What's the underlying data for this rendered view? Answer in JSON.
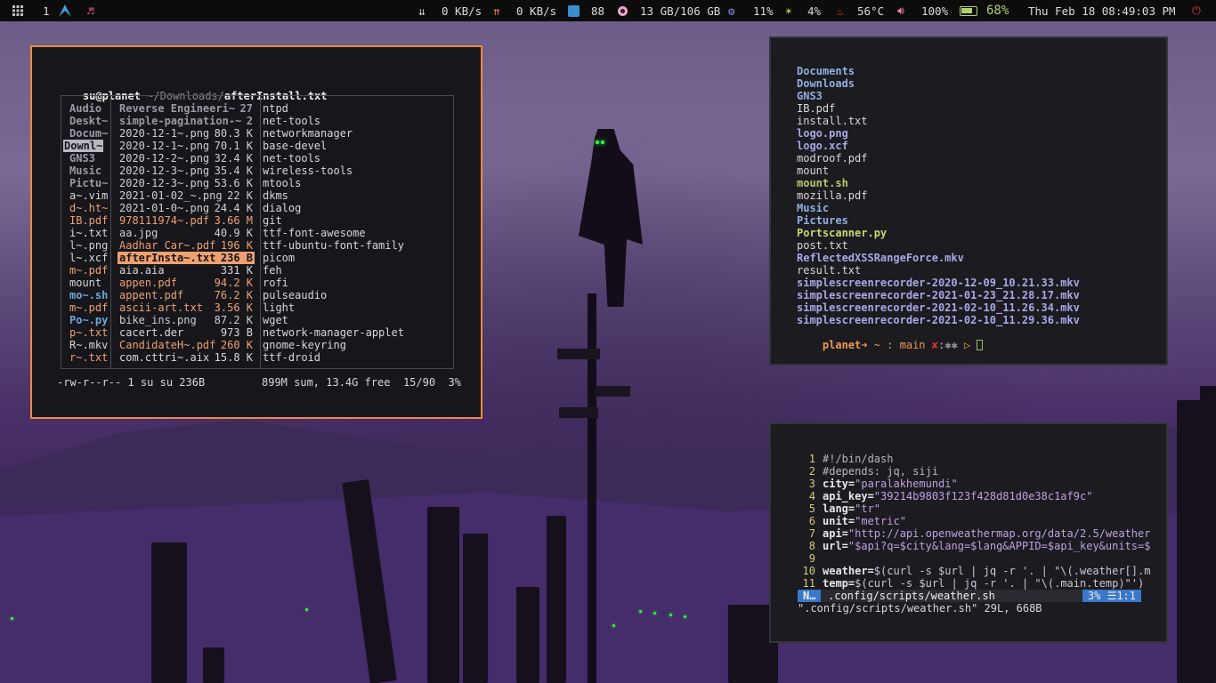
{
  "topbar": {
    "workspace": "1",
    "net_down": "0 KB/s",
    "net_up": "0 KB/s",
    "packages": "88",
    "disk": "13 GB/106 GB",
    "cpu": "11%",
    "brightness": "4%",
    "temp": "56°C",
    "volume": "100%",
    "battery": "68%",
    "datetime": "Thu Feb 18 08:49:03 PM"
  },
  "ranger": {
    "path_user": "su@planet",
    "path_dir": "~/Downloads/",
    "path_file": "afterInstall.txt",
    "col1": [
      "Audio",
      "Deskt~",
      "Docum~",
      "Downl~",
      "GNS3",
      "Music",
      "Pictu~",
      "a~.vim",
      "d~.ht~",
      "IB.pdf",
      "i~.txt",
      "l~.png",
      "l~.xcf",
      "m~.pdf",
      "mount",
      "mo~.sh",
      "m~.pdf",
      "Po~.py",
      "p~.txt",
      "R~.mkv",
      "r~.txt"
    ],
    "col2_names": [
      "Reverse Engineeri~",
      "simple-pagination-~",
      "2020-12-1~.png",
      "2020-12-1~.png",
      "2020-12-2~.png",
      "2020-12-3~.png",
      "2020-12-3~.png",
      "2021-01-02_~.png",
      "2021-01-0~.png",
      "978111974~.pdf",
      "aa.jpg",
      "Aadhar Car~.pdf",
      "afterInsta~.txt",
      "aia.aia",
      "appen.pdf",
      "appent.pdf",
      "ascii-art.txt",
      "bike_ins.png",
      "cacert.der",
      "CandidateH~.pdf",
      "com.cttri~.aix"
    ],
    "col2_sizes": [
      "27",
      "2",
      "80.3 K",
      "70.1 K",
      "32.4 K",
      "35.4 K",
      "53.6 K",
      "22 K",
      "24.4 K",
      "3.66 M",
      "40.9 K",
      "196 K",
      "236 B",
      "331 K",
      "94.2 K",
      "76.2 K",
      "3.56 K",
      "87.2 K",
      "973 B",
      "260 K",
      "15.8 K"
    ],
    "col3": [
      "ntpd",
      "net-tools",
      "networkmanager",
      "base-devel",
      "net-tools",
      "wireless-tools",
      "mtools",
      "dkms",
      "dialog",
      "git",
      "ttf-font-awesome",
      "ttf-ubuntu-font-family",
      "picom",
      "feh",
      "rofi",
      "pulseaudio",
      "light",
      "wget",
      "network-manager-applet",
      "gnome-keyring",
      "ttf-droid"
    ],
    "status_perm": "-rw-r--r-- 1 su su 236B",
    "status_info": "899M sum, 13.4G free  15/90  3%"
  },
  "ls": {
    "items": [
      "Documents",
      "Downloads",
      "GNS3",
      "IB.pdf",
      "install.txt",
      "logo.png",
      "logo.xcf",
      "modroof.pdf",
      "mount",
      "mount.sh",
      "mozilla.pdf",
      "Music",
      "Pictures",
      "Portscanner.py",
      "post.txt",
      "ReflectedXSSRangeForce.mkv",
      "result.txt",
      "simplescreenrecorder-2020-12-09_10.21.33.mkv",
      "simplescreenrecorder-2021-01-23_21.28.17.mkv",
      "simplescreenrecorder-2021-02-10_11.26.34.mkv",
      "simplescreenrecorder-2021-02-10_11.29.36.mkv"
    ],
    "prompt_host": "planet",
    "prompt_rest": " ~ : main ",
    "prompt_x": "✘",
    "prompt_colon": ":",
    "prompt_tail": "▷ "
  },
  "vim": {
    "lines": [
      {
        "n": "1",
        "a": "#!/bin/dash",
        "b": ""
      },
      {
        "n": "2",
        "a": "#depends: jq, siji",
        "b": ""
      },
      {
        "n": "3",
        "a": "city=",
        "b": "\"paralakhemundi\""
      },
      {
        "n": "4",
        "a": "api_key=",
        "b": "\"39214b9803f123f428d81d0e38c1af9c\""
      },
      {
        "n": "5",
        "a": "lang=",
        "b": "\"tr\""
      },
      {
        "n": "6",
        "a": "unit=",
        "b": "\"metric\""
      },
      {
        "n": "7",
        "a": "api=",
        "b": "\"http://api.openweathermap.org/data/2.5/weather"
      },
      {
        "n": "8",
        "a": "url=",
        "b": "\"$api?q=$city&lang=$lang&APPID=$api_key&units=$"
      },
      {
        "n": "9",
        "a": "",
        "b": ""
      },
      {
        "n": "10",
        "a": "weather=",
        "b": "$(curl -s $url | jq -r '. | \"\\(.weather[].m"
      },
      {
        "n": "11",
        "a": "temp=",
        "b": "$(curl -s $url | jq -r '. | \"\\(.main.temp)\"')"
      }
    ],
    "mode": "N…",
    "filename": ".config/scripts/weather.sh",
    "position": "3% ☰1:1",
    "message": "\".config/scripts/weather.sh\" 29L, 668B"
  }
}
